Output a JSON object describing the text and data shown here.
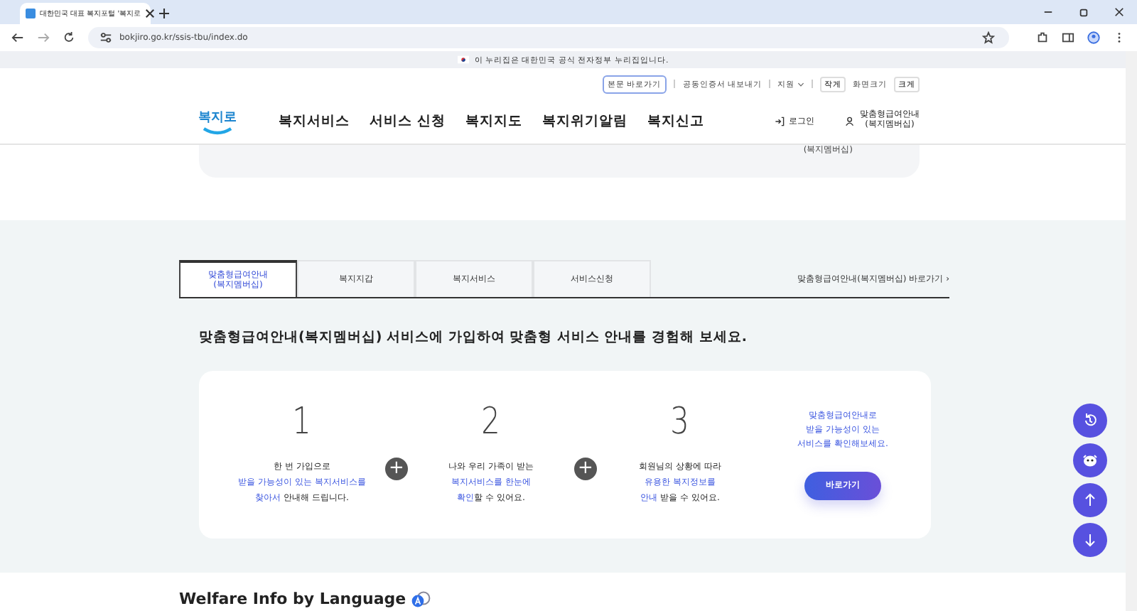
{
  "browser": {
    "tab_title": "대한민국 대표 복지포털 '복지로",
    "url": "bokjiro.go.kr/ssis-tbu/index.do"
  },
  "gov_banner": {
    "text": "이 누리집은 대한민국 공식 전자정부 누리집입니다."
  },
  "utility": {
    "links": [
      "본문 바로가기",
      "공동인증서 내보내기",
      "지원"
    ],
    "font_small": "작게",
    "font_label": "화면크기",
    "font_large": "크게"
  },
  "header": {
    "logo": "복지로",
    "nav": [
      "복지서비스",
      "서비스 신청",
      "복지지도",
      "복지위기알림",
      "복지신고"
    ],
    "login": "로그인",
    "membership": "맞춤형급여안내\n(복지멤버십)"
  },
  "submenu_remnant": {
    "text": "(복지멤버십)"
  },
  "tabs": [
    {
      "label": "맞춤형급여안내\n(복지멤버십)",
      "selected": true
    },
    {
      "label": "복지지갑",
      "selected": false
    },
    {
      "label": "복지서비스",
      "selected": false
    },
    {
      "label": "서비스신청",
      "selected": false
    }
  ],
  "tab_shortcut": "맞춤형급여안내(복지멤버십) 바로가기 ›",
  "heading": "맞춤형급여안내(복지멤버십) 서비스에 가입하여 맞춤형 서비스 안내를 경험해 보세요.",
  "steps": [
    {
      "number": "1",
      "segments": [
        {
          "text": "한 번 가입으로\n",
          "emphasis": false
        },
        {
          "text": "받을 가능성이 있는 복지서비스를\n찾아서",
          "emphasis": true
        },
        {
          "text": " 안내해 드립니다.",
          "emphasis": false
        }
      ]
    },
    {
      "number": "2",
      "segments": [
        {
          "text": "나와 우리 가족이 받는\n",
          "emphasis": false
        },
        {
          "text": "복지서비스를 한눈에\n확인",
          "emphasis": true
        },
        {
          "text": "할 수 있어요.",
          "emphasis": false
        }
      ]
    },
    {
      "number": "3",
      "segments": [
        {
          "text": "회원님의 상황에 따라\n",
          "emphasis": false
        },
        {
          "text": "유용한 복지정보를\n안내",
          "emphasis": true
        },
        {
          "text": " 받을 수 있어요.",
          "emphasis": false
        }
      ]
    }
  ],
  "plus_sign": "+",
  "cta": {
    "text": "맞춤형급여안내로\n받을 가능성이 있는\n서비스를 확인해보세요.",
    "button": "바로가기"
  },
  "bottom_heading": "Welfare Info by Language"
}
